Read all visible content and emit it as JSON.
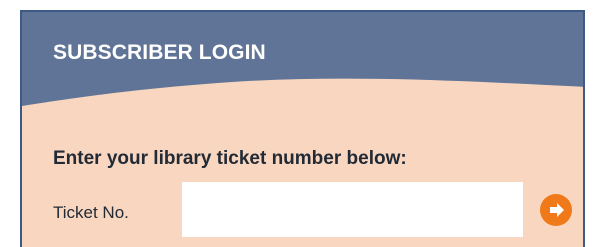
{
  "login": {
    "title": "SUBSCRIBER LOGIN",
    "prompt": "Enter your library ticket number below:",
    "field_label": "Ticket No.",
    "ticket_value": "",
    "submit_icon": "arrow-right-icon"
  },
  "colors": {
    "header": "#5f7497",
    "panel": "#f9d6bf",
    "border": "#3d5a86",
    "accent": "#f07a1a"
  }
}
